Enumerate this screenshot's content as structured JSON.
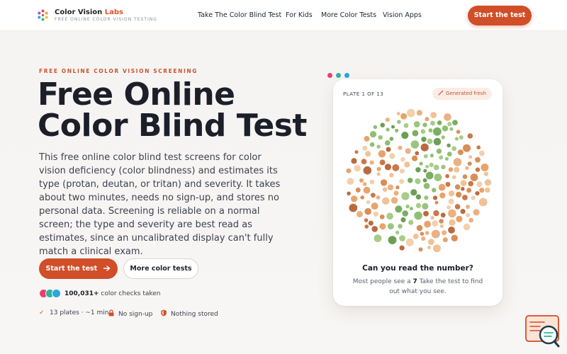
{
  "brand": {
    "name_part1": "Color Vision ",
    "name_part2": "Labs",
    "tagline": "FREE ONLINE COLOR VISION TESTING",
    "logo_icon": "rainbow-dots-icon"
  },
  "nav": [
    {
      "label": "Take The Color Blind Test"
    },
    {
      "label": "For Kids"
    },
    {
      "label": "More Color Tests"
    },
    {
      "label": "Vision Apps"
    }
  ],
  "header_cta": "Start the test",
  "hero": {
    "eyebrow": "FREE ONLINE COLOR VISION SCREENING",
    "title": "Free Online Color Blind Test",
    "description": "This free online color blind test screens for color vision deficiency (color blindness) and estimates its type (protan, deutan, or tritan) and severity. It takes about two minutes, needs no sign-up, and stores no personal data. Screening is reliable on a normal screen; the type and severity are best read as estimates, since an uncalibrated display can't fully match a clinical exam.",
    "primary_button": "Start the test",
    "primary_button_icon": "arrow-right-icon",
    "secondary_button": "More color tests",
    "stat_count": "100,031+",
    "stat_label": " color checks taken",
    "features": [
      {
        "icon": "check-icon",
        "label": "13 plates · ~1 min"
      },
      {
        "icon": "lock-icon",
        "label": "No sign-up"
      },
      {
        "icon": "shield-icon",
        "label": "Nothing stored"
      }
    ]
  },
  "card": {
    "plate_label": "PLATE 1 OF 13",
    "badge": "Generated fresh",
    "badge_icon": "magic-wand-icon",
    "question": "Can you read the number?",
    "hint_prefix": "Most people see a ",
    "hint_number": "7",
    "hint_suffix": "  Take the test to find out what you see."
  },
  "colors": {
    "accent": "#d04e28",
    "plate_background": [
      "#e8a36b",
      "#d98e57",
      "#f0c295",
      "#c9784a",
      "#eab184",
      "#f2d0ae",
      "#b96b40"
    ],
    "plate_figure": [
      "#8fbf72",
      "#7aae60",
      "#a6cc86",
      "#6b9f55",
      "#9cc47e"
    ],
    "avatars": [
      "#e8416d",
      "#2fb3a0",
      "#2aa6e0"
    ],
    "window_dots": [
      "#e8416d",
      "#2fb3a0",
      "#2aa6e0"
    ]
  },
  "chat_widget_icon": "chat-search-icon"
}
